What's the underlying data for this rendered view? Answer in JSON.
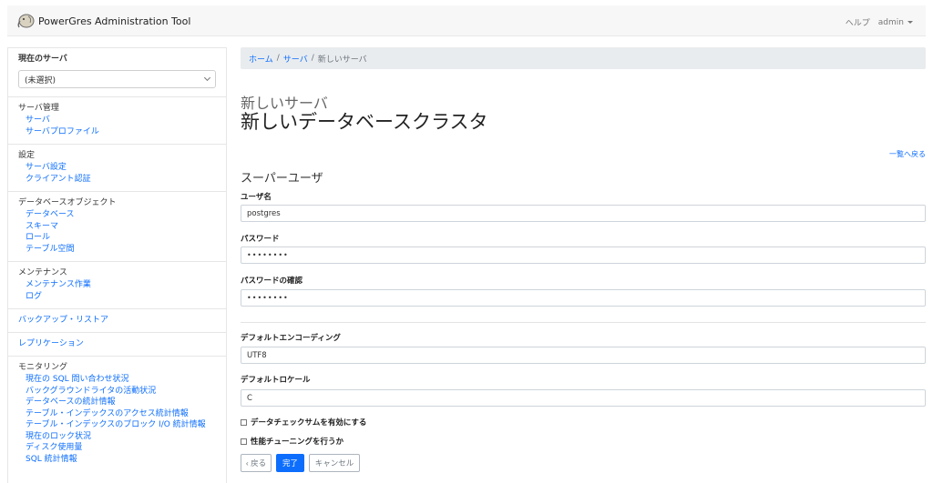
{
  "navbar": {
    "brand": "PowerGres Administration Tool",
    "help": "ヘルプ",
    "user": "admin"
  },
  "sidebar": {
    "current_server": {
      "heading": "現在のサーバ",
      "selected": "(未選択)"
    },
    "server_mgmt": {
      "heading": "サーバ管理",
      "items": [
        "サーバ",
        "サーバプロファイル"
      ]
    },
    "settings": {
      "heading": "設定",
      "items": [
        "サーバ設定",
        "クライアント認証"
      ]
    },
    "db_objects": {
      "heading": "データベースオブジェクト",
      "items": [
        "データベース",
        "スキーマ",
        "ロール",
        "テーブル空間"
      ]
    },
    "maintenance": {
      "heading": "メンテナンス",
      "items": [
        "メンテナンス作業",
        "ログ"
      ]
    },
    "backup": {
      "heading": "バックアップ・リストア"
    },
    "replication": {
      "heading": "レプリケーション"
    },
    "monitoring": {
      "heading": "モニタリング",
      "items": [
        "現在の SQL 問い合わせ状況",
        "バックグラウンドライタの活動状況",
        "データベースの統計情報",
        "テーブル・インデックスのアクセス統計情報",
        "テーブル・インデックスのブロック I/O 統計情報",
        "現在のロック状況",
        "ディスク使用量",
        "SQL 統計情報"
      ]
    }
  },
  "breadcrumb": {
    "home": "ホーム",
    "servers": "サーバ",
    "current": "新しいサーバ"
  },
  "page": {
    "subtitle": "新しいサーバ",
    "title": "新しいデータベースクラスタ",
    "back_to_list": "一覧へ戻る",
    "section_superuser": "スーパーユーザ"
  },
  "form": {
    "username_label": "ユーザ名",
    "username_value": "postgres",
    "password_label": "パスワード",
    "password_value": "••••••••",
    "password_confirm_label": "パスワードの確認",
    "password_confirm_value": "••••••••",
    "encoding_label": "デフォルトエンコーディング",
    "encoding_value": "UTF8",
    "locale_label": "デフォルトロケール",
    "locale_value": "C",
    "checksum_label": "データチェックサムを有効にする",
    "tuning_label": "性能チューニングを行うか"
  },
  "buttons": {
    "back": "‹ 戻る",
    "done": "完了",
    "cancel": "キャンセル"
  }
}
